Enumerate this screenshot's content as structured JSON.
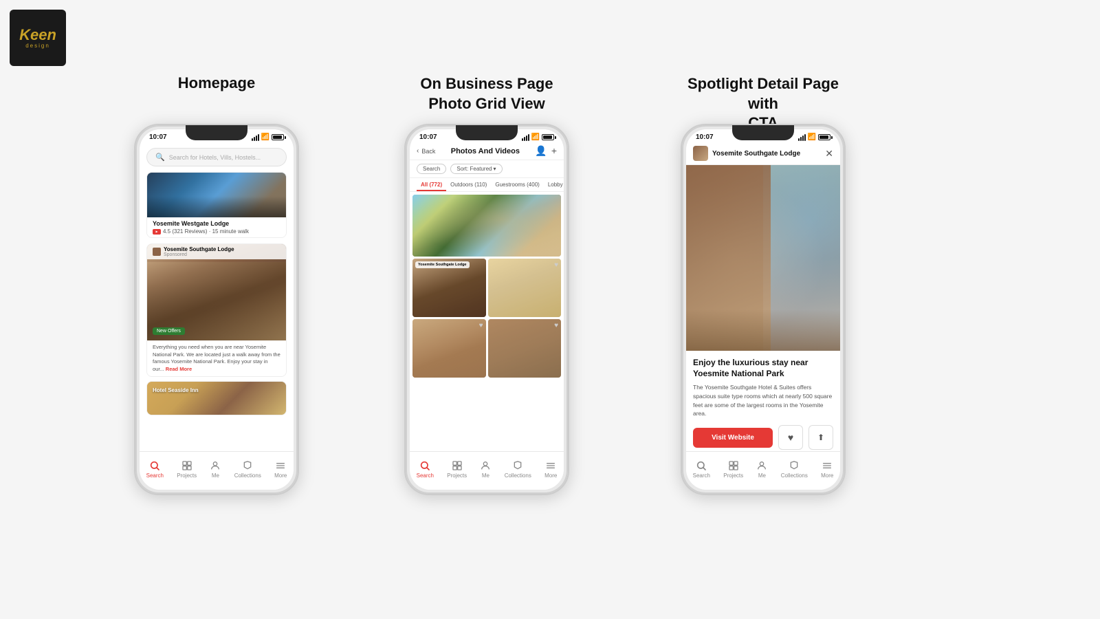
{
  "logo": {
    "text": "Keen",
    "sub": "design"
  },
  "sections": [
    {
      "id": "homepage",
      "title": "Homepage",
      "title_line2": ""
    },
    {
      "id": "business-page",
      "title": "On Business Page",
      "title_line2": "Photo Grid View"
    },
    {
      "id": "spotlight",
      "title": "Spotlight Detail Page with",
      "title_line2": "CTA"
    }
  ],
  "phone1": {
    "time": "10:07",
    "search_placeholder": "Search for Hotels, Vills, Hostels...",
    "hotel1": {
      "name": "Yosemite Westgate Lodge",
      "rating": "4.5 (321 Reviews) · 15 minute walk"
    },
    "hotel2": {
      "name": "Yosemite Southgate Lodge",
      "sponsored": "Sponsored",
      "new_offers": "New Offers",
      "desc": "Everything you need when you are near Yosemite National Park. We are located just a walk away from the famous Yosemite National Park. Enjoy your stay in our...",
      "read_more": "Read More"
    },
    "hotel3": {
      "name": "Hotel Seaside Inn"
    },
    "nav": {
      "items": [
        {
          "label": "Search",
          "active": true
        },
        {
          "label": "Projects",
          "active": false
        },
        {
          "label": "Me",
          "active": false
        },
        {
          "label": "Collections",
          "active": false
        },
        {
          "label": "More",
          "active": false
        }
      ]
    }
  },
  "phone2": {
    "time": "10:07",
    "header": {
      "back": "Back",
      "title": "Photos And Videos"
    },
    "filters": {
      "search": "Search",
      "sort": "Sort: Featured"
    },
    "tabs": [
      {
        "label": "All (772)",
        "active": true
      },
      {
        "label": "Outdoors (110)",
        "active": false
      },
      {
        "label": "Guestrooms (400)",
        "active": false
      },
      {
        "label": "Lobby (",
        "active": false
      }
    ],
    "photo_overlay": {
      "hotel_name": "Yosemite Southgate Lodge"
    },
    "nav": {
      "items": [
        {
          "label": "Search",
          "active": true
        },
        {
          "label": "Projects",
          "active": false
        },
        {
          "label": "Me",
          "active": false
        },
        {
          "label": "Collections",
          "active": false
        },
        {
          "label": "More",
          "active": false
        }
      ]
    }
  },
  "phone3": {
    "time": "10:07",
    "hotel_name": "Yosemite Southgate Lodge",
    "detail": {
      "title": "Enjoy the luxurious stay near Yoesmite National Park",
      "desc": "The Yosemite Southgate Hotel & Suites offers spacious suite type rooms which at nearly 500 square feet are some of the largest rooms in the Yosemite area.",
      "cta": "Visit Website"
    },
    "nav": {
      "items": [
        {
          "label": "Search",
          "active": false
        },
        {
          "label": "Projects",
          "active": false
        },
        {
          "label": "Me",
          "active": false
        },
        {
          "label": "Collections",
          "active": false
        },
        {
          "label": "More",
          "active": false
        }
      ]
    }
  }
}
